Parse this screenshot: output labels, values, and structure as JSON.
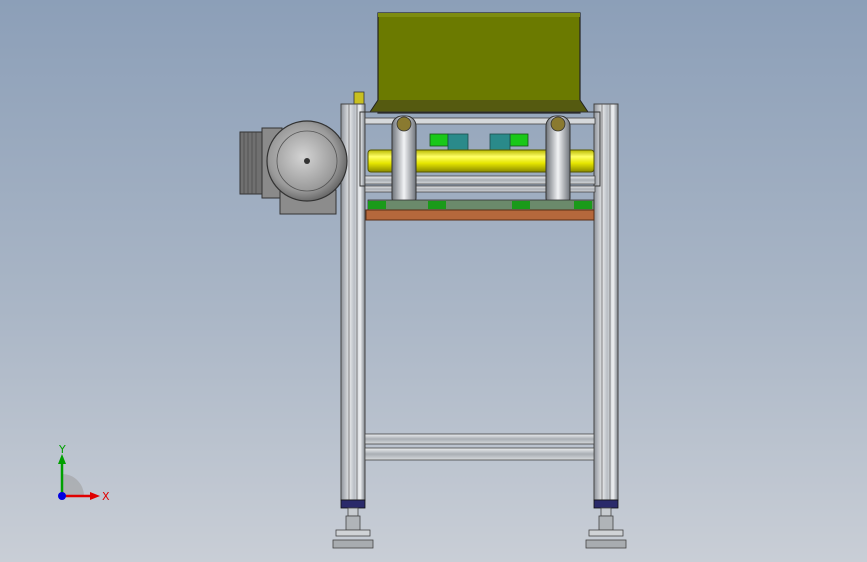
{
  "scene": {
    "colors": {
      "background_top": "#8c9fb8",
      "background_bottom": "#c9ced6",
      "hopper": "#6b7a00",
      "shaft": "#f2f200",
      "motor": "#9a9a9a",
      "frame": "#c8ccd0",
      "plate": "#b5683c",
      "bearing_blocks": "#19c819",
      "foot_caps": "#2a2a6a"
    },
    "components": [
      "hopper",
      "drive-shaft",
      "gear-motor",
      "left-frame-post",
      "right-frame-post",
      "base-plate",
      "lower-crossbar",
      "leveling-feet",
      "roller-wheels"
    ]
  },
  "triad": {
    "x_label": "X",
    "y_label": "Y",
    "x_color": "#e00000",
    "y_color": "#00a000",
    "z_color": "#0000e0"
  }
}
